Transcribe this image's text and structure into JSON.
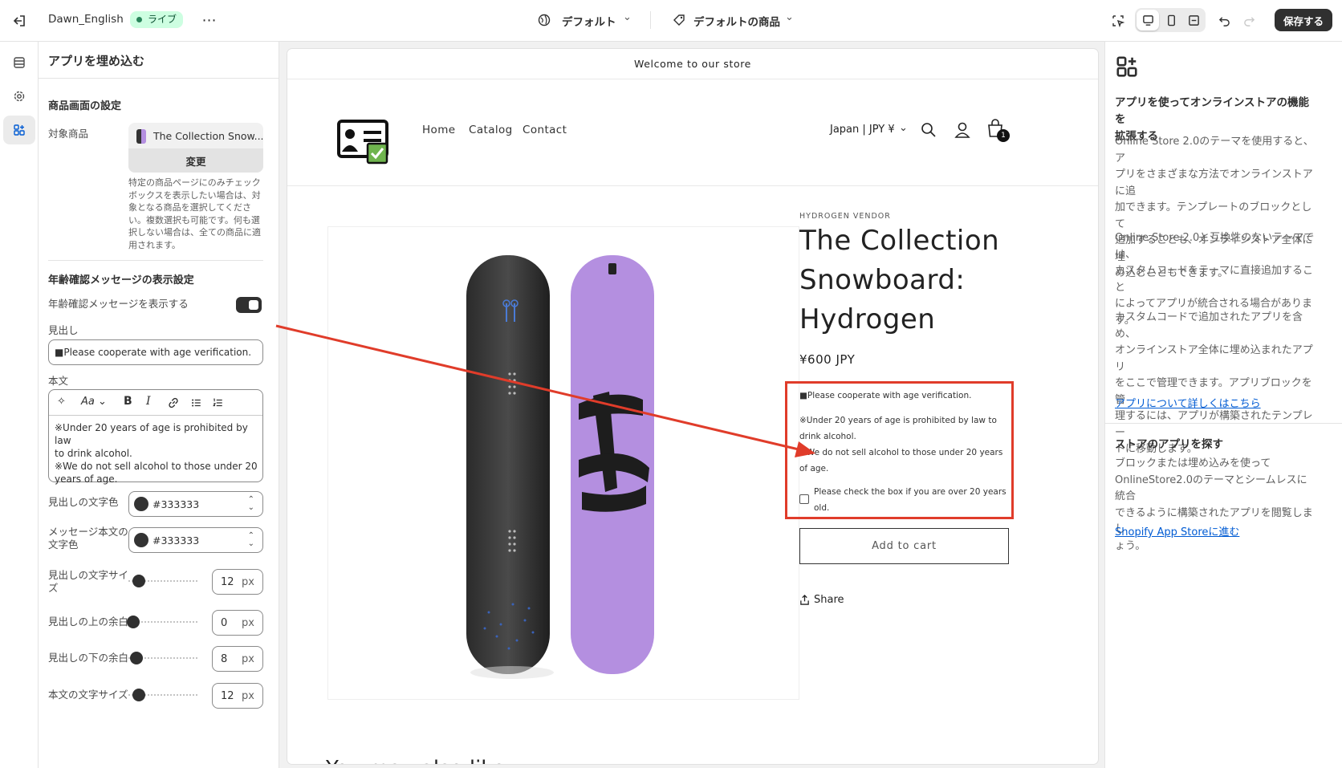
{
  "topbar": {
    "store_name": "Dawn_English",
    "live_badge": "ライブ",
    "theme_select": "デフォルト",
    "template_select": "デフォルトの商品",
    "save_label": "保存する"
  },
  "panel": {
    "title": "アプリを埋め込む",
    "product_section_heading": "商品画面の設定",
    "target_product_label": "対象商品",
    "target_product_value": "The Collection Snow...",
    "change_button": "変更",
    "help_lines": [
      "特定の商品ページにのみチェック",
      "ボックスを表示したい場合は、対",
      "象となる商品を選択してくださ",
      "い。複数選択も可能です。何も選",
      "択しない場合は、全ての商品に適",
      "用されます。"
    ],
    "age_section_heading": "年齢確認メッセージの表示設定",
    "show_toggle_label": "年齢確認メッセージを表示する",
    "show_toggle_on": true,
    "heading_label": "見出し",
    "heading_value": "■Please cooperate with age verification.",
    "body_label": "本文",
    "body_lines": [
      "※Under 20 years of age is prohibited by law",
      "to drink alcohol.",
      "※We do not sell alcohol to those under 20",
      "years of age."
    ],
    "heading_color_label": "見出しの文字色",
    "heading_color_value": "#333333",
    "body_color_label_1": "メッセージ本文の",
    "body_color_label_2": "文字色",
    "body_color_value": "#333333",
    "heading_size_label_1": "見出しの文字サイ",
    "heading_size_label_2": "ズ",
    "heading_size_value": "12",
    "heading_top_label": "見出しの上の余白",
    "heading_top_value": "0",
    "heading_bottom_label": "見出しの下の余白",
    "heading_bottom_value": "8",
    "body_size_label": "本文の文字サイズ",
    "body_size_value": "12",
    "unit": "px",
    "colors": {
      "swatch": "#333333"
    }
  },
  "preview": {
    "announcement": "Welcome to our store",
    "nav": [
      "Home",
      "Catalog",
      "Contact"
    ],
    "currency": "Japan | JPY ¥",
    "cart_count": "1",
    "vendor": "HYDROGEN VENDOR",
    "product_title_lines": [
      "The Collection",
      "Snowboard:",
      "Hydrogen"
    ],
    "price": "¥600 JPY",
    "age_heading": "■Please cooperate with age verification.",
    "age_body_lines": [
      "※Under 20 years of age is prohibited by law to",
      "drink alcohol.",
      "※We do not sell alcohol to those under 20 years",
      "of age."
    ],
    "checkbox_lines": [
      "Please check the box if you are over 20 years",
      "old."
    ],
    "add_to_cart": "Add to cart",
    "share": "Share",
    "bottom_partial": "You may also like"
  },
  "right_panel": {
    "heading1_lines": [
      "アプリを使ってオンラインストアの機能を",
      "拡張する"
    ],
    "p1_lines": [
      "Online Store 2.0のテーマを使用すると、ア",
      "プリをさまざまな方法でオンラインストアに追",
      "加できます。テンプレートのブロックとして",
      "追加することも、オンラインストア全体に埋",
      "め込むこともできます。"
    ],
    "p2_lines": [
      "Online Store 2.0と互換性のないテーマでは、",
      "カスタムコードをテーマに直接追加すること",
      "によってアプリが統合される場合がありま",
      "す。"
    ],
    "p3_lines": [
      "カスタムコードで追加されたアプリを含め、",
      "オンラインストア全体に埋め込まれたアプリ",
      "をここで管理できます。アプリブロックを管",
      "理するには、アプリが構築されたテンプレー",
      "トに移動します。"
    ],
    "link1": "アプリについて詳しくはこちら",
    "heading2": "ストアのアプリを探す",
    "p4_lines": [
      "ブロックまたは埋め込みを使って",
      "OnlineStore2.0のテーマとシームレスに統合",
      "できるように構築されたアプリを閲覧しまし",
      "ょう。"
    ],
    "link2": "Shopify App Storeに進む"
  },
  "annotation_color": "#e03c2a"
}
